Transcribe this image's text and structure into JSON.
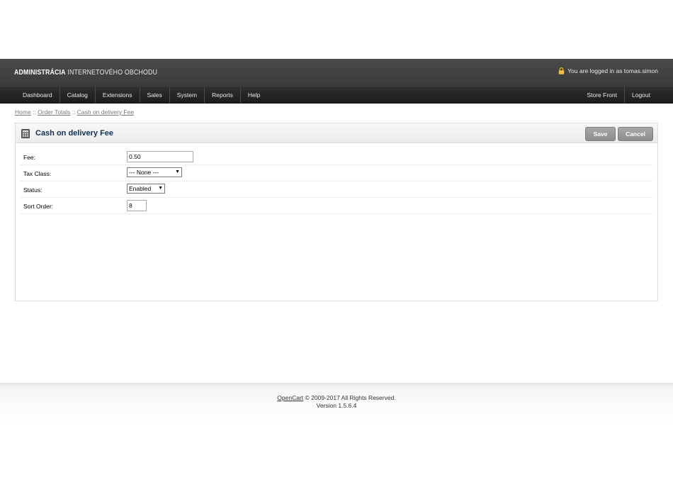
{
  "header": {
    "logo_bold": "ADMINISTRÁCIA",
    "logo_light": "INTERNETOVÉHO OBCHODU",
    "login_text": "You are logged in as tomas.simon"
  },
  "menu": {
    "left": [
      "Dashboard",
      "Catalog",
      "Extensions",
      "Sales",
      "System",
      "Reports",
      "Help"
    ],
    "right": [
      "Store Front",
      "Logout"
    ]
  },
  "breadcrumb": {
    "items": [
      "Home",
      "Order Totals",
      "Cash on delivery Fee"
    ],
    "separator": " :: "
  },
  "box": {
    "title": "Cash on delivery Fee",
    "save_label": "Save",
    "cancel_label": "Cancel"
  },
  "form": {
    "fee_label": "Fee:",
    "fee_value": "0.50",
    "tax_class_label": "Tax Class:",
    "tax_class_value": "--- None ---",
    "status_label": "Status:",
    "status_value": "Enabled",
    "sort_order_label": "Sort Order:",
    "sort_order_value": "8"
  },
  "footer": {
    "brand": "OpenCart",
    "copyright": " © 2009-2017 All Rights Reserved.",
    "version": "Version 1.5.6.4"
  },
  "colors": {
    "header_bg": "#424242",
    "menu_bg": "#262626",
    "title_color": "#0e3057",
    "button_bg": "#999999"
  }
}
